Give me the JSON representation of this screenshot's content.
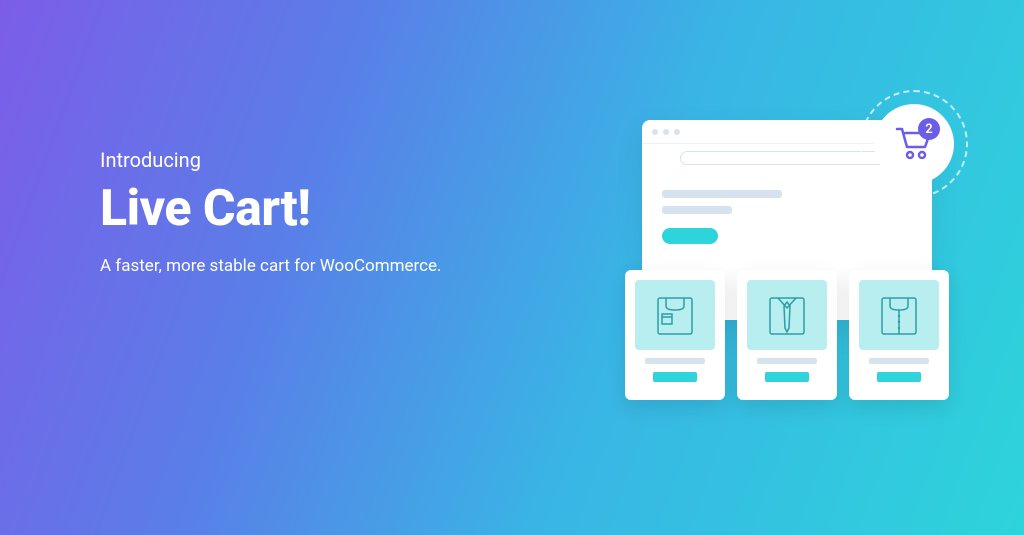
{
  "hero": {
    "small": "Introducing",
    "title": "Live Cart!",
    "subtitle": "A faster, more stable cart for WooCommerce."
  },
  "cart": {
    "count": "2"
  }
}
